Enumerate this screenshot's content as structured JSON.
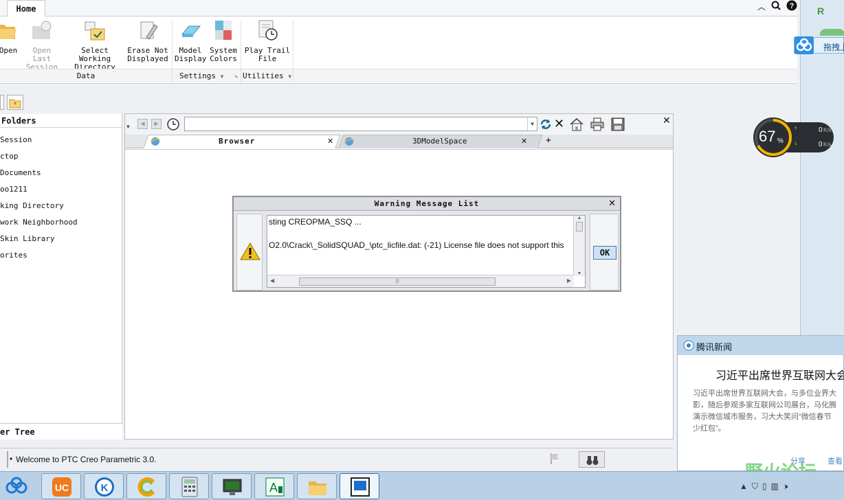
{
  "ribbon": {
    "home_tab": "Home",
    "buttons": [
      {
        "label1": "Open",
        "label2": ""
      },
      {
        "label1": "Open Last",
        "label2": "Session"
      },
      {
        "label1": "Select Working",
        "label2": "Directory"
      },
      {
        "label1": "Erase Not",
        "label2": "Displayed"
      },
      {
        "label1": "Model",
        "label2": "Display"
      },
      {
        "label1": "System",
        "label2": "Colors"
      },
      {
        "label1": "Play Trail",
        "label2": "File"
      }
    ],
    "groups": {
      "data": "Data",
      "settings": "Settings",
      "utilities": "Utilities"
    }
  },
  "folders": {
    "header": "Folders",
    "items": [
      "Session",
      "ctop",
      "Documents",
      "oo1211",
      "king Directory",
      "work Neighborhood",
      "Skin Library",
      "orites"
    ],
    "footer": "er Tree"
  },
  "browser": {
    "url": "",
    "tabs": [
      "Browser",
      "3DModelSpace"
    ]
  },
  "dialog": {
    "title": "Warning Message List",
    "line1": "sting CREOPMA_SSQ ...",
    "line2": "O2.0\\Crack\\_SolidSQUAD_\\ptc_licfile.dat: (-21) License file does not support this",
    "ok": "OK"
  },
  "status": {
    "message": "Welcome to PTC Creo Parametric 3.0."
  },
  "netspeed": {
    "percent": "67",
    "percent_unit": "%",
    "up": "0",
    "down": "0",
    "unit": "K/s"
  },
  "news": {
    "source": "腾讯新闻",
    "headline": "习近平出席世界互联网大会",
    "body1": "习近平出席世界互联网大会，与多位业界大",
    "body2": "影，随后参观多家互联网公司展台，马化腾",
    "body3": "演示微信城市服务，习大大笑问“微信春节",
    "body4": "少红包”。",
    "footer_left": "分享",
    "footer_right": "查看",
    "watermark": "野火论坛"
  },
  "side": {
    "drag_label": "拖拽上"
  },
  "colors": {
    "accent": "#4a78b0",
    "warning": "#f0c020"
  }
}
